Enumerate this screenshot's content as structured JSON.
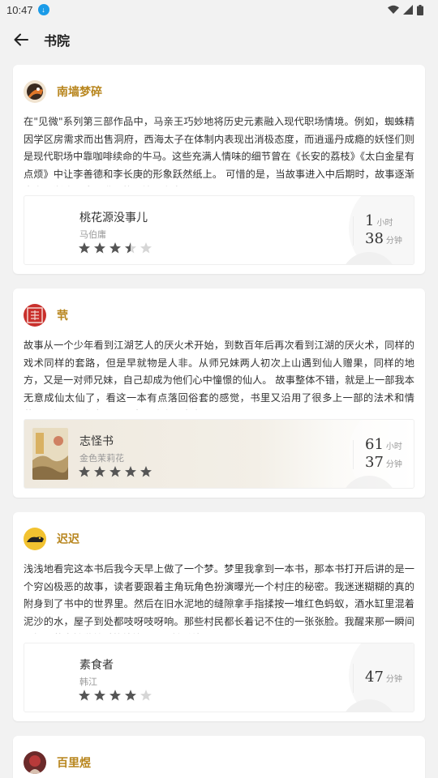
{
  "status": {
    "time": "10:47"
  },
  "header": {
    "title": "书院"
  },
  "cards": [
    {
      "username": "南墙梦碎",
      "review": "在\"见微\"系列第三部作品中，马亲王巧妙地将历史元素融入现代职场情境。例如，蜘蛛精因学区房需求而出售洞府，西海太子在体制内表现出消极态度，而逍遥丹成瘾的妖怪们则是现代职场中靠咖啡续命的牛马。这些充满人情味的细节曾在《长安的荔枝》《太白金星有点烦》中让李善德和李长庚的形象跃然纸上。 可惜的是，当故事进入中后期时，故事逐渐走向逐渐陷入陈词滥调的困境。玄穹…",
      "book": {
        "title": "桃花源没事儿",
        "author": "马伯庸",
        "rating": 3.5,
        "hours": "1",
        "hours_unit": "小时",
        "minutes": "38",
        "minutes_unit": "分钟"
      }
    },
    {
      "username": "茕",
      "review": "故事从一个少年看到江湖艺人的厌火术开始，到数百年后再次看到江湖的厌火术，同样的戏术同样的套路，但是早就物是人非。从师兄妹两人初次上山遇到仙人赠果，同样的地方，又是一对师兄妹，自己却成为他们心中憧憬的仙人。 故事整体不错，就是上一部我本无意成仙太仙了，看这一本有点落回俗套的感觉，书里又沿用了很多上一部的法术和情节，不知道是有意还是无意，让人不由自…",
      "book": {
        "title": "志怪书",
        "author": "金色茉莉花",
        "rating": 5,
        "hours": "61",
        "hours_unit": "小时",
        "minutes": "37",
        "minutes_unit": "分钟"
      }
    },
    {
      "username": "迟迟",
      "review": "浅浅地看完这本书后我今天早上做了一个梦。梦里我拿到一本书，那本书打开后讲的是一个穷凶极恶的故事，读者要跟着主角玩角色扮演曝光一个村庄的秘密。我迷迷糊糊的真的附身到了书中的世界里。然后在旧水泥地的缝隙拿手指揉按一堆红色蚂蚁，酒水缸里混着泥沙的水，屋子到处都吱呀吱呀响。那些村民都长着记不住的一张张脸。我醒来那一瞬间理解了英惠她做梦时的处境，以及她后续…",
      "book": {
        "title": "素食者",
        "author": "韩江",
        "rating": 4,
        "minutes": "47",
        "minutes_unit": "分钟"
      }
    },
    {
      "username": "百里煜"
    }
  ]
}
